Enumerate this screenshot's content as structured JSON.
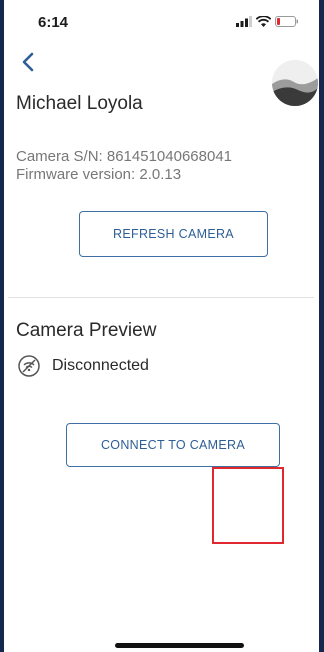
{
  "status_bar": {
    "time": "6:14",
    "icons": [
      "signal-icon",
      "wifi-icon",
      "battery-icon"
    ]
  },
  "nav": {
    "back_icon": "chevron-left-icon"
  },
  "user": {
    "name": "Michael Loyola",
    "avatar_icon": "landscape-avatar"
  },
  "camera": {
    "serial_label": "Camera S/N:",
    "serial_value": "861451040668041",
    "firmware_label": "Firmware version:",
    "firmware_value": "2.0.13",
    "refresh_label": "REFRESH CAMERA"
  },
  "preview": {
    "title": "Camera Preview",
    "status_icon": "wifi-off-icon",
    "status_text": "Disconnected",
    "connect_label": "CONNECT TO CAMERA"
  },
  "colors": {
    "accent": "#2d5e96",
    "frame": "#14284d",
    "highlight": "#e0282e"
  }
}
